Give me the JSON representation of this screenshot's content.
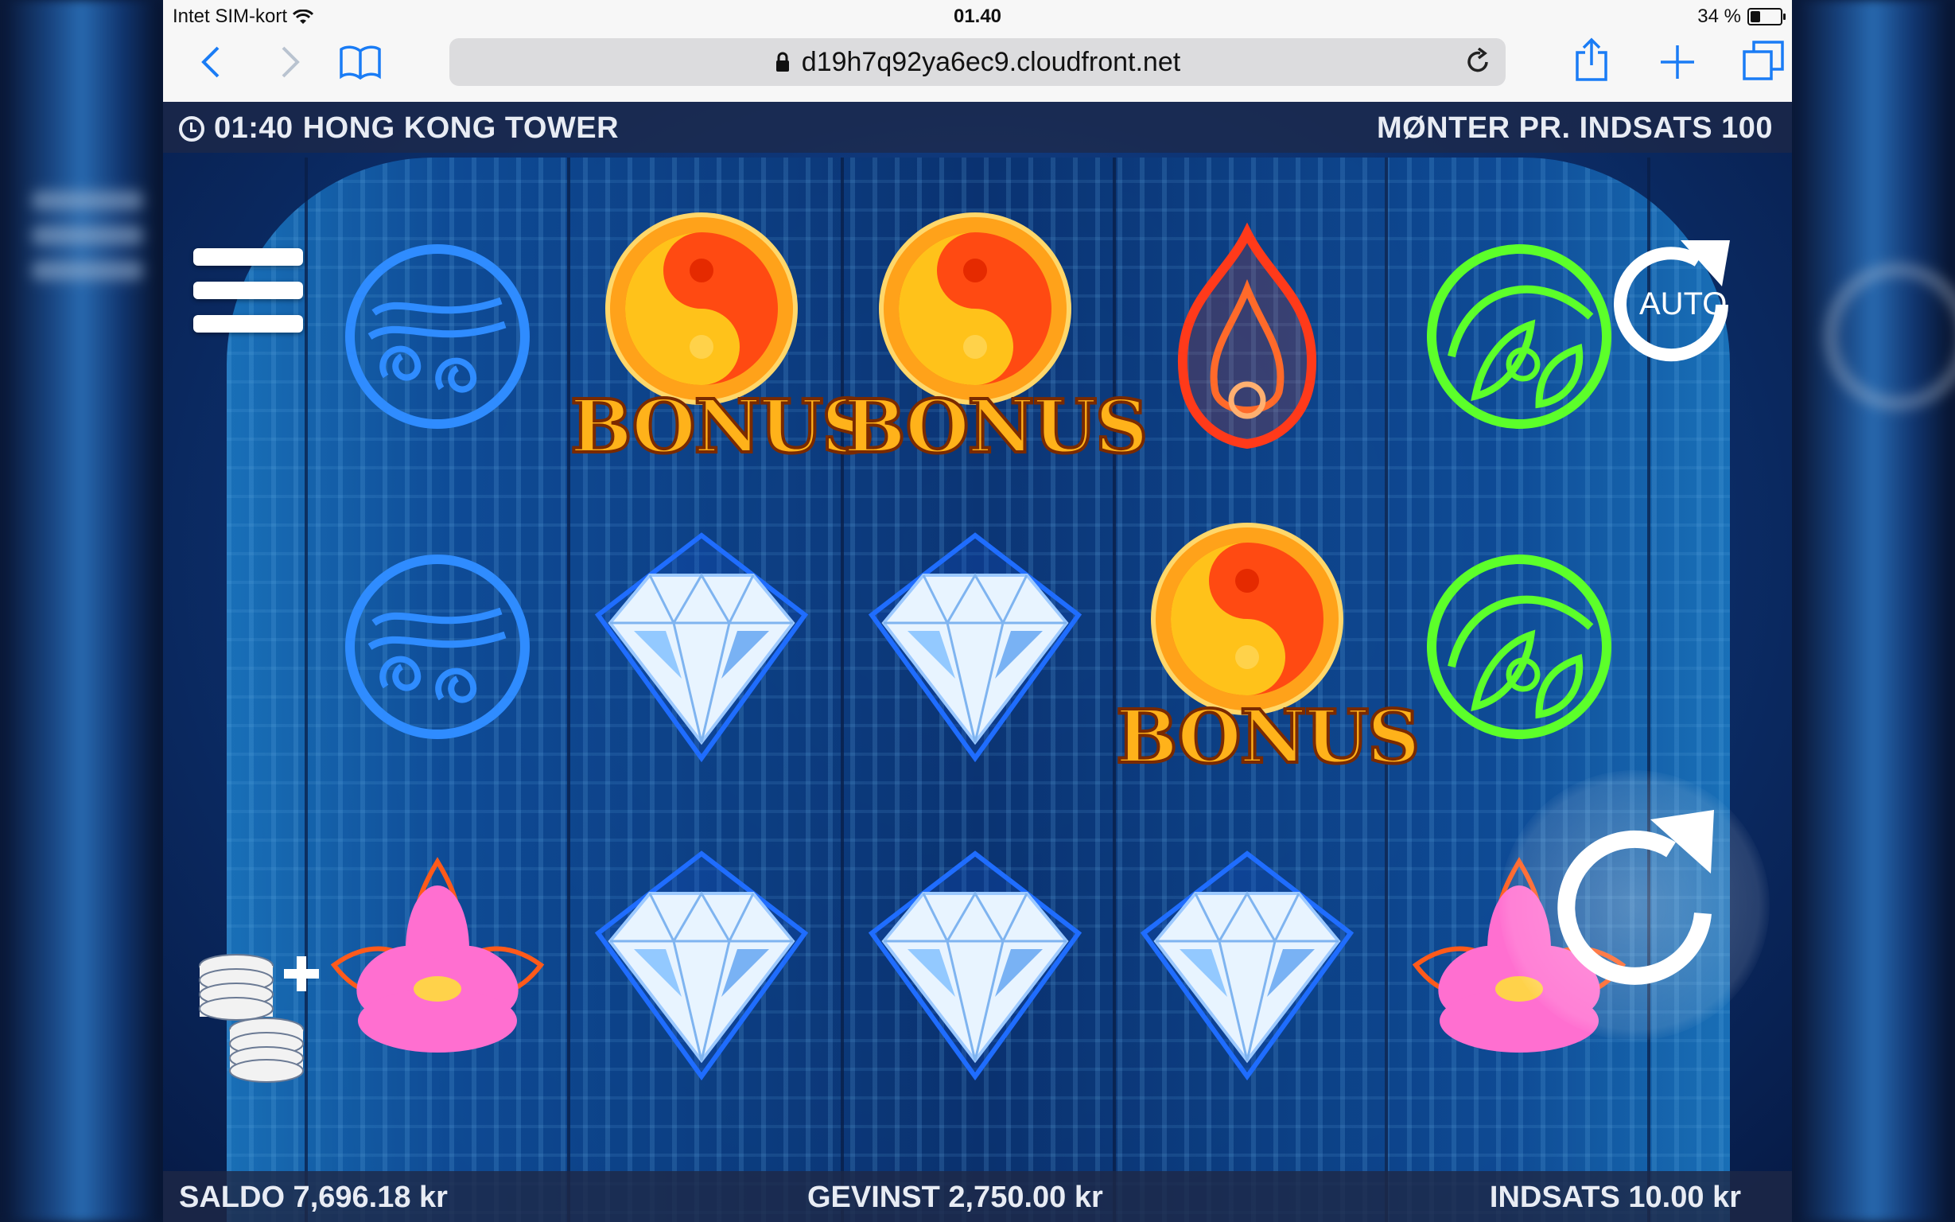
{
  "status_bar": {
    "carrier": "Intet SIM-kort",
    "time": "01.40",
    "battery_label": "34 %",
    "battery_level": 0.34
  },
  "browser": {
    "url": "d19h7q92ya6ec9.cloudfront.net",
    "icons": [
      "back-icon",
      "forward-icon",
      "bookmarks-icon",
      "lock-icon",
      "reload-icon",
      "share-icon",
      "new-tab-icon",
      "tabs-icon"
    ]
  },
  "game": {
    "clock": "01:40",
    "title": "HONG KONG TOWER",
    "coins_per_bet": "MØNTER PR. INDSATS 100",
    "balance": "SALDO 7,696.18 kr",
    "win": "GEVINST 2,750.00 kr",
    "bet": "INDSATS 10.00 kr",
    "auto_label": "AUTO",
    "bonus_label": "BONUS",
    "reels": [
      [
        "water",
        "water",
        "lotus"
      ],
      [
        "bonus",
        "diamond",
        "diamond"
      ],
      [
        "bonus",
        "diamond",
        "diamond"
      ],
      [
        "fire",
        "bonus",
        "diamond"
      ],
      [
        "leaf",
        "leaf",
        "lotus"
      ]
    ],
    "colors": {
      "water": "#2f8cff",
      "fire": "#ff3a1a",
      "leaf": "#5cff2a",
      "lotus": "#ff6fd0",
      "bonus_gold": "#ffb21a"
    }
  }
}
